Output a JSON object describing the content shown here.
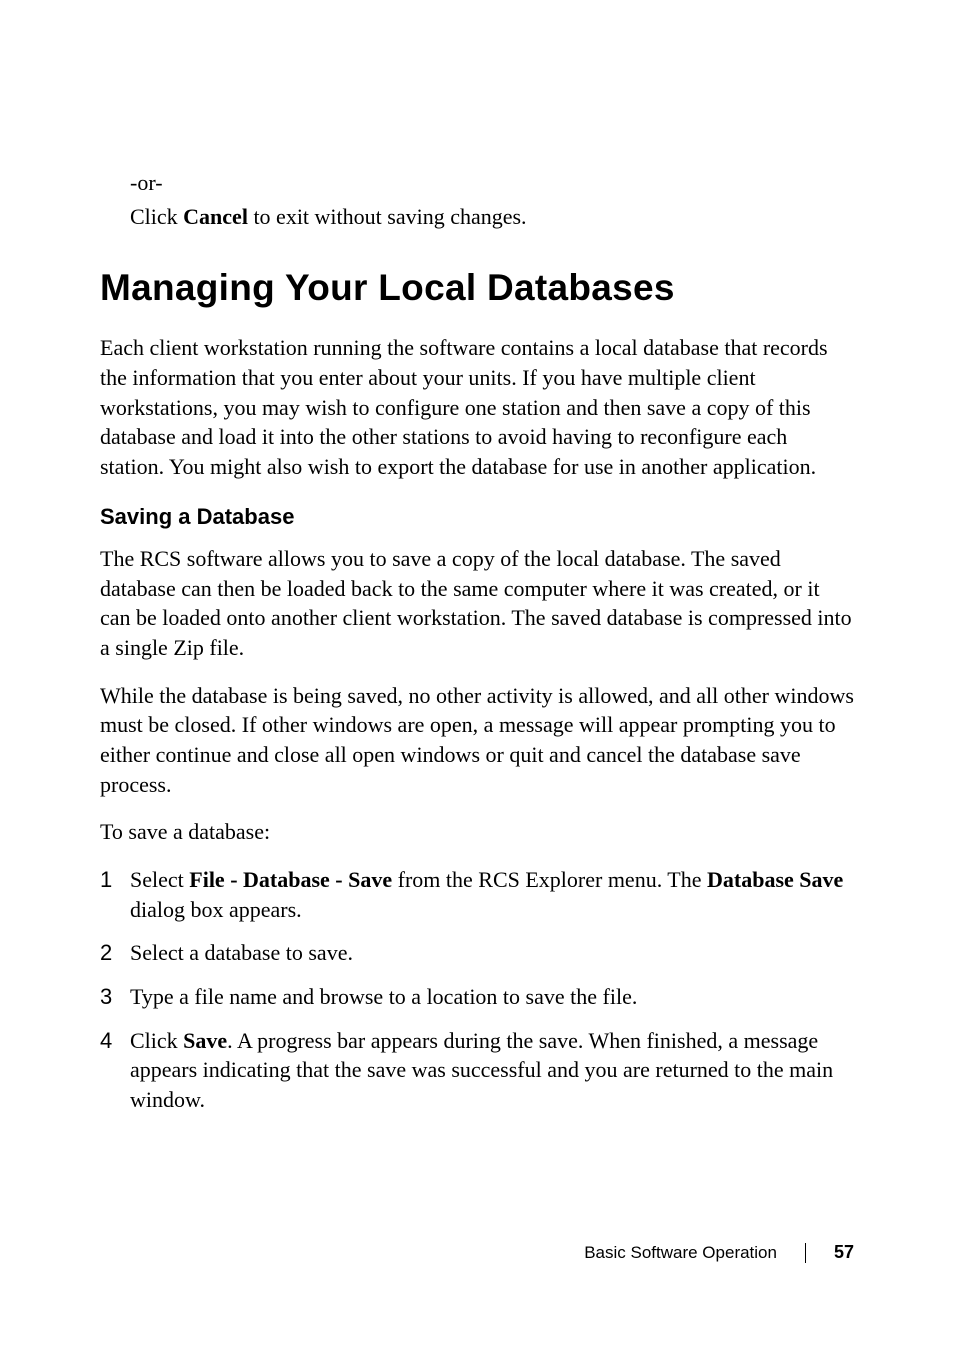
{
  "continued": {
    "or": "-or-",
    "cancel_line_prefix": "Click ",
    "cancel_bold": "Cancel",
    "cancel_line_suffix": " to exit without saving changes."
  },
  "heading1": "Managing Your Local Databases",
  "intro_para": "Each client workstation running the software contains a local database that records the information that you enter about your units. If you have multiple client workstations, you may wish to configure one station and then save a copy of this database and load it into the other stations to avoid having to reconfigure each station. You might also wish to export the database for use in another application.",
  "heading2": "Saving a Database",
  "para2": "The RCS software allows you to save a copy of the local database. The saved database can then be loaded back to the same computer where it was created, or it can be loaded onto another client workstation. The saved database is compressed into a single Zip file.",
  "para3": "While the database is being saved, no other activity is allowed, and all other windows must be closed. If other windows are open, a message will appear prompting you to either continue and close all open windows or quit and cancel the database save process.",
  "lead_in": "To save a database:",
  "steps": [
    {
      "num": "1",
      "prefix": "Select ",
      "bold1": "File - Database - Save",
      "mid": " from the RCS Explorer menu. The ",
      "bold2": "Database Save",
      "suffix": " dialog box appears."
    },
    {
      "num": "2",
      "text": "Select a database to save."
    },
    {
      "num": "3",
      "text": "Type a file name and browse to a location to save the file."
    },
    {
      "num": "4",
      "prefix": "Click ",
      "bold1": "Save",
      "suffix": ". A progress bar appears during the save. When finished, a message appears indicating that the save was successful and you are returned to the main window."
    }
  ],
  "footer": {
    "section": "Basic Software Operation",
    "page": "57"
  }
}
